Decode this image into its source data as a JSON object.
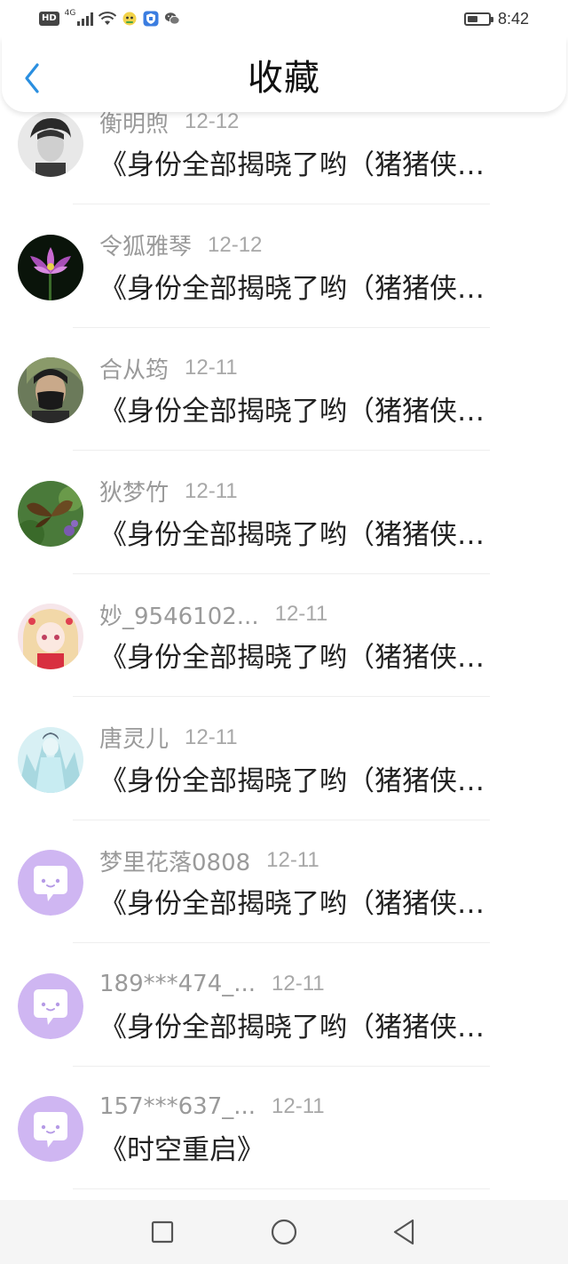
{
  "status_bar": {
    "hd_label": "HD",
    "network": "4G",
    "time": "8:42",
    "battery_level": 0.5
  },
  "header": {
    "title": "收藏",
    "back_icon": "chevron-left-icon"
  },
  "favorites": [
    {
      "author": "衡明煦",
      "date": "12-12",
      "title": "《身份全部揭晓了哟（猪猪侠…",
      "avatar": "photo-portrait-boy"
    },
    {
      "author": "令狐雅琴",
      "date": "12-12",
      "title": "《身份全部揭晓了哟（猪猪侠…",
      "avatar": "photo-lotus"
    },
    {
      "author": "合从筠",
      "date": "12-11",
      "title": "《身份全部揭晓了哟（猪猪侠…",
      "avatar": "photo-masked-boy"
    },
    {
      "author": "狄梦竹",
      "date": "12-11",
      "title": "《身份全部揭晓了哟（猪猪侠…",
      "avatar": "photo-butterfly"
    },
    {
      "author": "妙_9546102...",
      "date": "12-11",
      "title": "《身份全部揭晓了哟（猪猪侠…",
      "avatar": "photo-anime-girl"
    },
    {
      "author": "唐灵儿",
      "date": "12-11",
      "title": "《身份全部揭晓了哟（猪猪侠…",
      "avatar": "photo-ice-figure"
    },
    {
      "author": "梦里花落0808",
      "date": "12-11",
      "title": "《身份全部揭晓了哟（猪猪侠…",
      "avatar": "default-chat-avatar"
    },
    {
      "author": "189***474_...",
      "date": "12-11",
      "title": "《身份全部揭晓了哟（猪猪侠…",
      "avatar": "default-chat-avatar"
    },
    {
      "author": "157***637_...",
      "date": "12-11",
      "title": "《时空重启》",
      "avatar": "default-chat-avatar"
    }
  ],
  "nav_bar": {
    "icons": [
      "recents-square-icon",
      "home-circle-icon",
      "back-triangle-icon"
    ]
  },
  "colors": {
    "accent": "#2a8fe0",
    "default_avatar": "#cfb6f2"
  }
}
